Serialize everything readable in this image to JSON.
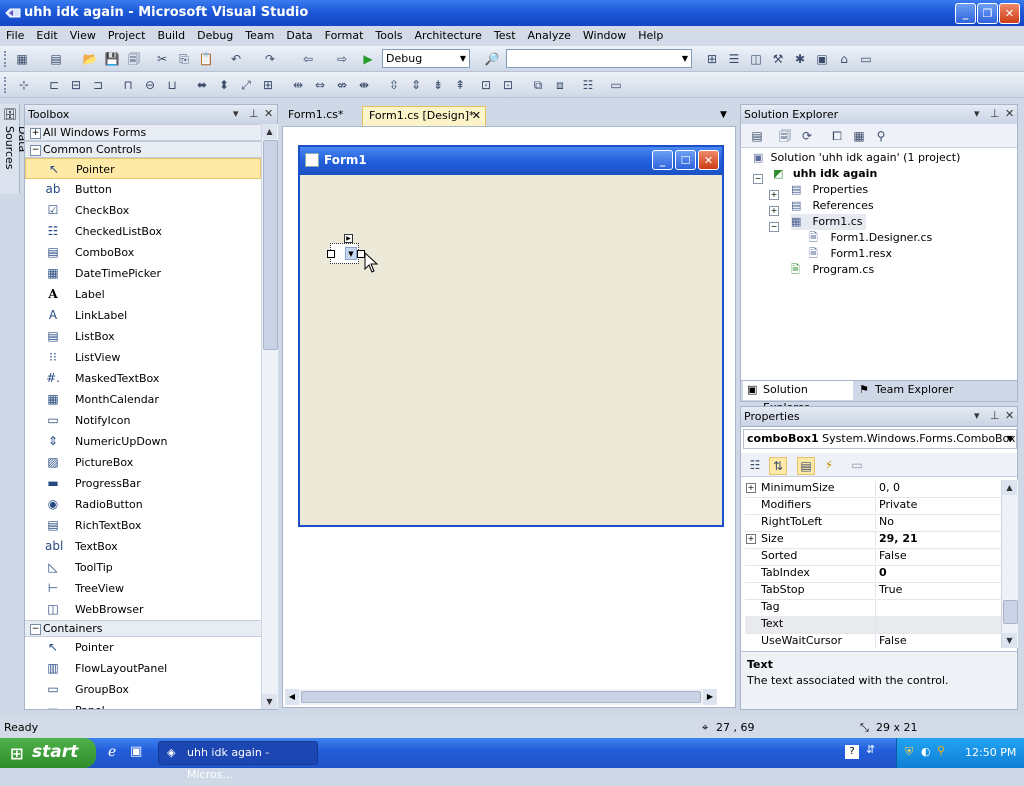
{
  "window": {
    "title": "uhh idk again - Microsoft Visual Studio"
  },
  "menu": [
    "File",
    "Edit",
    "View",
    "Project",
    "Build",
    "Debug",
    "Team",
    "Data",
    "Format",
    "Tools",
    "Architecture",
    "Test",
    "Analyze",
    "Window",
    "Help"
  ],
  "toolbar": {
    "config_combo": "Debug",
    "platform_combo": ""
  },
  "side_tab": {
    "label": "Data Sources"
  },
  "toolbox": {
    "title": "Toolbox",
    "groups": [
      {
        "label": "All Windows Forms",
        "expanded": false
      },
      {
        "label": "Common Controls",
        "expanded": true,
        "items": [
          "Pointer",
          "Button",
          "CheckBox",
          "CheckedListBox",
          "ComboBox",
          "DateTimePicker",
          "Label",
          "LinkLabel",
          "ListBox",
          "ListView",
          "MaskedTextBox",
          "MonthCalendar",
          "NotifyIcon",
          "NumericUpDown",
          "PictureBox",
          "ProgressBar",
          "RadioButton",
          "RichTextBox",
          "TextBox",
          "ToolTip",
          "TreeView",
          "WebBrowser"
        ]
      },
      {
        "label": "Containers",
        "expanded": true,
        "items": [
          "Pointer",
          "FlowLayoutPanel",
          "GroupBox",
          "Panel"
        ]
      }
    ]
  },
  "doc_tabs": [
    {
      "label": "Form1.cs*",
      "active": false
    },
    {
      "label": "Form1.cs [Design]*",
      "active": true
    }
  ],
  "form": {
    "title": "Form1"
  },
  "solution_explorer": {
    "title": "Solution Explorer",
    "solution": "Solution 'uhh idk again' (1 project)",
    "project": "uhh idk again",
    "nodes": [
      "Properties",
      "References",
      "Form1.cs",
      "Form1.Designer.cs",
      "Form1.resx",
      "Program.cs"
    ],
    "tabs": [
      "Solution Explorer",
      "Team Explorer"
    ]
  },
  "properties": {
    "title": "Properties",
    "object_name": "comboBox1",
    "object_type": "System.Windows.Forms.ComboBox",
    "rows": [
      {
        "name": "MinimumSize",
        "value": "0, 0",
        "expandable": true,
        "bold": false
      },
      {
        "name": "Modifiers",
        "value": "Private",
        "expandable": false,
        "bold": false
      },
      {
        "name": "RightToLeft",
        "value": "No",
        "expandable": false,
        "bold": false
      },
      {
        "name": "Size",
        "value": "29, 21",
        "expandable": true,
        "bold": true
      },
      {
        "name": "Sorted",
        "value": "False",
        "expandable": false,
        "bold": false
      },
      {
        "name": "TabIndex",
        "value": "0",
        "expandable": false,
        "bold": true
      },
      {
        "name": "TabStop",
        "value": "True",
        "expandable": false,
        "bold": false
      },
      {
        "name": "Tag",
        "value": "",
        "expandable": false,
        "bold": false
      },
      {
        "name": "Text",
        "value": "",
        "expandable": false,
        "bold": false
      },
      {
        "name": "UseWaitCursor",
        "value": "False",
        "expandable": false,
        "bold": false
      }
    ],
    "desc_title": "Text",
    "desc_text": "The text associated with the control."
  },
  "status": {
    "text": "Ready",
    "position": "27 , 69",
    "size": "29 x 21"
  },
  "taskbar": {
    "start": "start",
    "task": "uhh idk again - Micros...",
    "clock": "12:50 PM"
  }
}
